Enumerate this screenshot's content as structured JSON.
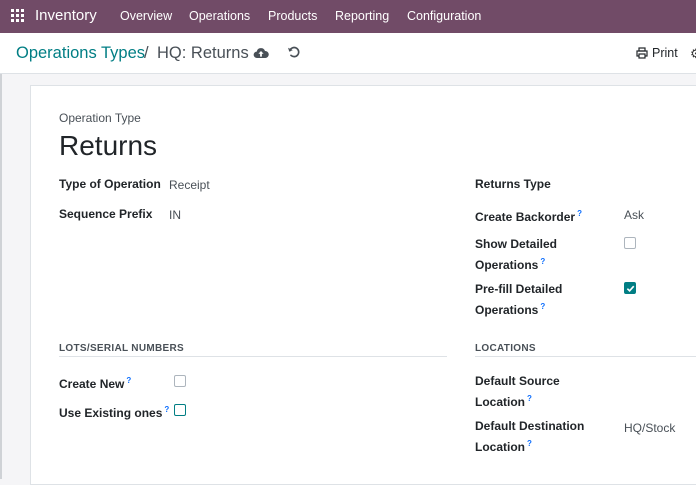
{
  "navbar": {
    "app_name": "Inventory",
    "menus": [
      "Overview",
      "Operations",
      "Products",
      "Reporting",
      "Configuration"
    ]
  },
  "control_panel": {
    "breadcrumb_parent": "Operations Types",
    "breadcrumb_separator": "/",
    "breadcrumb_current": "HQ: Returns",
    "print_label": "Print"
  },
  "form": {
    "header_label": "Operation Type",
    "title": "Returns",
    "type_of_operation": {
      "label": "Type of Operation",
      "value": "Receipt"
    },
    "sequence_prefix": {
      "label": "Sequence Prefix",
      "value": "IN"
    },
    "returns_type": {
      "label": "Returns Type"
    },
    "create_backorder": {
      "label": "Create Backorder",
      "value": "Ask"
    },
    "show_detailed_operations": {
      "label_line1": "Show Detailed",
      "label_line2": "Operations",
      "checked": false
    },
    "prefill_detailed_operations": {
      "label_line1": "Pre-fill Detailed",
      "label_line2": "Operations",
      "checked": true
    },
    "lots_section": {
      "title": "LOTS/SERIAL NUMBERS",
      "create_new": {
        "label": "Create New",
        "checked": false
      },
      "use_existing": {
        "label": "Use Existing ones",
        "checked": false
      }
    },
    "locations_section": {
      "title": "LOCATIONS",
      "default_source": {
        "label_line1": "Default Source",
        "label_line2": "Location",
        "value": ""
      },
      "default_destination": {
        "label_line1": "Default Destination",
        "label_line2": "Location",
        "value": "HQ/Stock"
      }
    },
    "help_marker": "?"
  },
  "colors": {
    "navbar": "#714b67",
    "accent": "#017e84"
  }
}
